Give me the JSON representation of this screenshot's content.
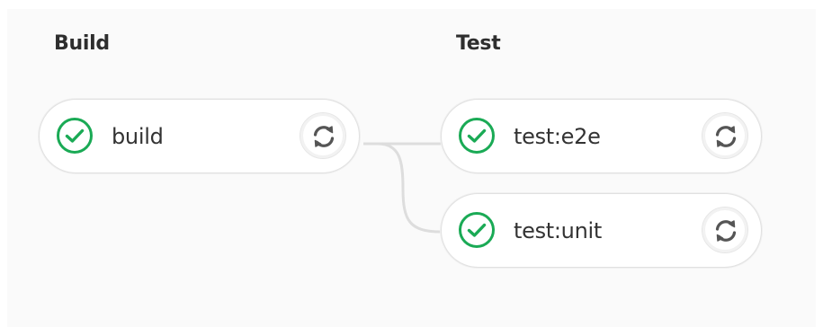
{
  "stages": [
    {
      "title": "Build",
      "jobs": [
        {
          "name": "build",
          "status": "passed",
          "status_icon": "check-circle-icon",
          "action_icon": "retry-icon"
        }
      ]
    },
    {
      "title": "Test",
      "jobs": [
        {
          "name": "test:e2e",
          "status": "passed",
          "status_icon": "check-circle-icon",
          "action_icon": "retry-icon"
        },
        {
          "name": "test:unit",
          "status": "passed",
          "status_icon": "check-circle-icon",
          "action_icon": "retry-icon"
        }
      ]
    }
  ],
  "colors": {
    "success": "#1aaa55",
    "connector": "#dddddd",
    "retry_icon": "#555555"
  }
}
